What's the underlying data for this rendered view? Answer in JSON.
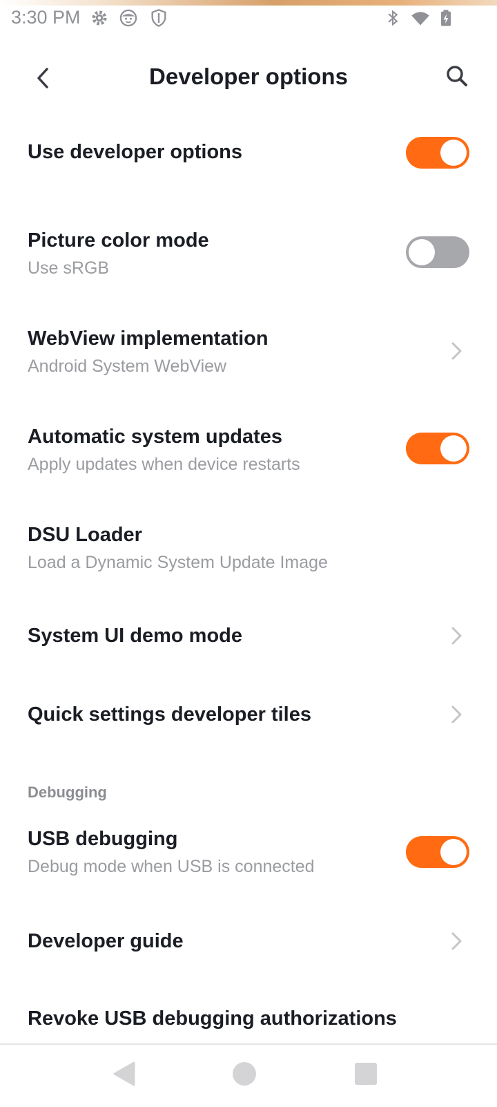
{
  "status_bar": {
    "time": "3:30 PM",
    "icons": [
      "settings-gear-icon",
      "face-icon",
      "shield-icon",
      "bluetooth-icon",
      "wifi-icon",
      "battery-charging-icon"
    ]
  },
  "app_bar": {
    "title": "Developer options",
    "back_icon": "chevron-left-icon",
    "search_icon": "search-icon"
  },
  "settings": {
    "use_dev_options": {
      "title": "Use developer options",
      "state": "on"
    },
    "picture_color_mode": {
      "title": "Picture color mode",
      "subtitle": "Use sRGB",
      "state": "off"
    },
    "webview_impl": {
      "title": "WebView implementation",
      "subtitle": "Android System WebView"
    },
    "auto_updates": {
      "title": "Automatic system updates",
      "subtitle": "Apply updates when device restarts",
      "state": "on"
    },
    "dsu_loader": {
      "title": "DSU Loader",
      "subtitle": "Load a Dynamic System Update Image"
    },
    "demo_mode": {
      "title": "System UI demo mode"
    },
    "qs_tiles": {
      "title": "Quick settings developer tiles"
    },
    "debugging_header": "Debugging",
    "usb_debugging": {
      "title": "USB debugging",
      "subtitle": "Debug mode when USB is connected",
      "state": "on"
    },
    "dev_guide": {
      "title": "Developer guide"
    },
    "revoke_usb": {
      "title": "Revoke USB debugging authorizations"
    }
  },
  "colors": {
    "accent": "#ff6a12",
    "toggle_off": "#a7a8ac",
    "subtitle": "#9a9ca1"
  },
  "nav_bar": {
    "icons": [
      "nav-back-icon",
      "nav-home-icon",
      "nav-recents-icon"
    ]
  }
}
